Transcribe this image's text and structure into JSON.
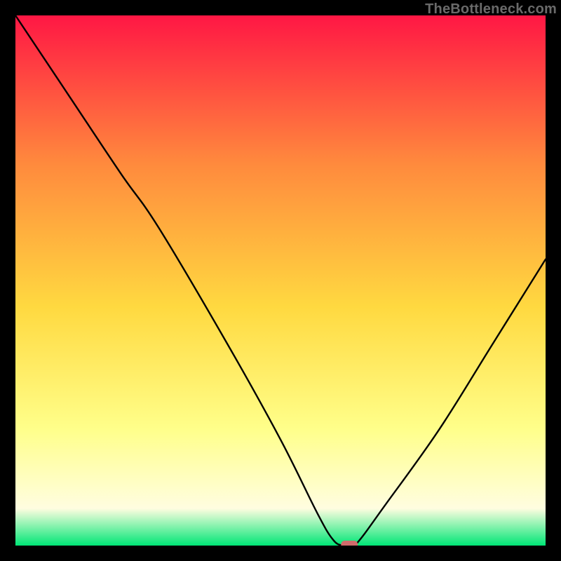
{
  "watermark": "TheBottleneck.com",
  "chart_data": {
    "type": "line",
    "title": "",
    "xlabel": "",
    "ylabel": "",
    "xlim": [
      0,
      100
    ],
    "ylim": [
      0,
      100
    ],
    "grid": false,
    "legend": false,
    "series": [
      {
        "name": "bottleneck-curve",
        "x": [
          0,
          10,
          20,
          27,
          40,
          50,
          57,
          60,
          62,
          64,
          70,
          80,
          90,
          100
        ],
        "values": [
          100,
          85,
          70,
          60,
          38,
          20,
          6,
          1,
          0,
          0,
          8,
          22,
          38,
          54
        ]
      }
    ],
    "marker": {
      "name": "optimal-point",
      "x": 63,
      "y": 0,
      "color": "#d06b6b"
    },
    "background_gradient": {
      "top": "#ff1744",
      "upper_mid": "#ff8a3d",
      "mid": "#ffd940",
      "lower_mid": "#ffff8a",
      "near_bottom": "#fffde0",
      "bottom": "#00e676"
    }
  }
}
